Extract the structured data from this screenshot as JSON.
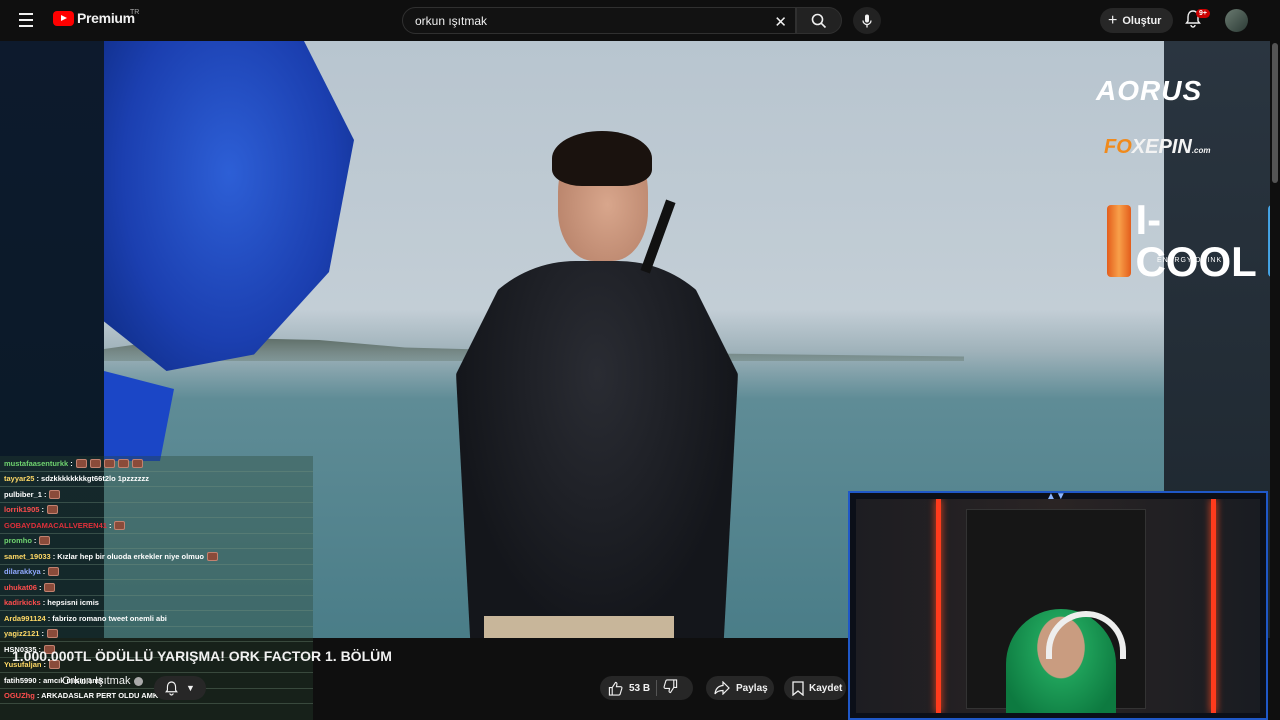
{
  "header": {
    "logo_text": "Premium",
    "region": "TR",
    "search_value": "orkun ışıtmak",
    "create_label": "Oluştur",
    "notification_badge": "9+"
  },
  "sponsors": {
    "aorus": "AORUS",
    "foxepin_accent": "FO",
    "foxepin_rest": "XEPIN",
    "foxepin_domain": ".com",
    "icool": "I-COOL",
    "icool_sub": "ENERGY DRINK"
  },
  "chat": [
    {
      "user": "mustafaasenturkk",
      "msg": ":",
      "color": "#6fd36f",
      "emotes": 5
    },
    {
      "user": "tayyar25",
      "msg": ": sdzkkkkkkkkgt66t2lo 1pzzzzzz",
      "color": "#ffd966",
      "emotes": 0
    },
    {
      "user": "pulbiber_1",
      "msg": ":",
      "color": "#ffffff",
      "emotes": 1
    },
    {
      "user": "lorrik1905",
      "msg": ":",
      "color": "#ff4d4d",
      "emotes": 1
    },
    {
      "user": "GOBAYDAMACALLVEREN41",
      "msg": ":",
      "color": "#e0303a",
      "emotes": 1
    },
    {
      "user": "promho",
      "msg": ":",
      "color": "#6fd36f",
      "emotes": 1
    },
    {
      "user": "samet_19033",
      "msg": ": Kızlar hep bir oluoda erkekler niye olmuo",
      "color": "#ffd966",
      "emotes": 1
    },
    {
      "user": "dilarakkya",
      "msg": ":",
      "color": "#8fa8ff",
      "emotes": 1
    },
    {
      "user": "uhukat06",
      "msg": ":",
      "color": "#ff4d4d",
      "emotes": 1
    },
    {
      "user": "kadirkicks",
      "msg": ": hepsisni icmis",
      "color": "#ff4d4d",
      "emotes": 0
    },
    {
      "user": "Arda991124",
      "msg": ": fabrizo romano tweet onemli abi",
      "color": "#ffd966",
      "emotes": 0
    },
    {
      "user": "yagiz2121",
      "msg": ":",
      "color": "#ffd966",
      "emotes": 1
    },
    {
      "user": "HSN0335",
      "msg": ":",
      "color": "#ffffff",
      "emotes": 1
    },
    {
      "user": "Yusufaljan",
      "msg": ":",
      "color": "#ffd966",
      "emotes": 1
    },
    {
      "user": "fatih5990",
      "msg": ": amcık mısın amk",
      "color": "#ffffff",
      "emotes": 0
    },
    {
      "user": "OGUZhg",
      "msg": ": ARKADASLAR PERT OLDU AMK",
      "color": "#ff4d4d",
      "emotes": 0
    }
  ],
  "video": {
    "title": "1.000.000TL ÖDÜLLÜ YARIŞMA! ORK FACTOR 1. BÖLÜM",
    "channel": "Orkun Işıtmak",
    "likes": "53 B",
    "share_label": "Paylaş",
    "save_label": "Kaydet"
  },
  "colors": {
    "brand_red": "#ff0000",
    "cam_border": "#1f58c8"
  }
}
